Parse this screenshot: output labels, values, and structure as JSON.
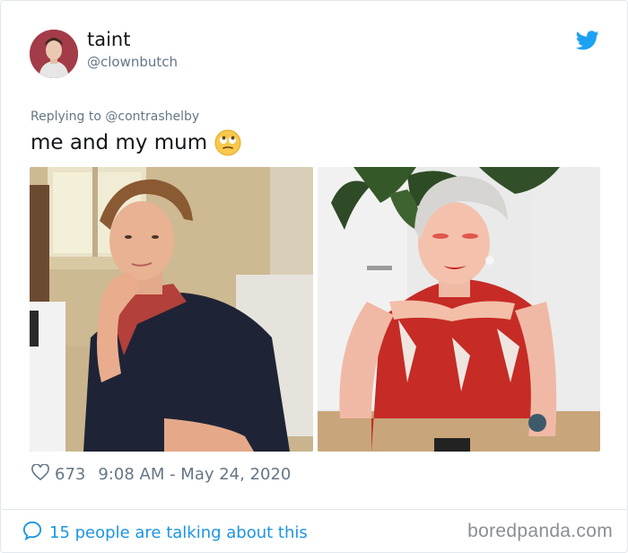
{
  "profile": {
    "display_name": "taint",
    "handle": "@clownbutch",
    "avatar_icon": "profile-photo"
  },
  "brand": {
    "icon": "twitter-bird-icon",
    "color": "#1da1f2"
  },
  "tweet": {
    "replying_to": "Replying to @contrashelby",
    "text": "me and my mum",
    "emoji": "face-with-rolling-eyes"
  },
  "photos": [
    {
      "name": "photo-vintage-mother"
    },
    {
      "name": "photo-modern-selfie"
    }
  ],
  "meta": {
    "like_icon": "heart-outline-icon",
    "likes": "673",
    "time": "9:08 AM - May 24, 2020"
  },
  "footer": {
    "talking_icon": "speech-bubble-icon",
    "talking_text": "15 people are talking about this",
    "watermark": "boredpanda.com",
    "link_color": "#1b95e0"
  }
}
